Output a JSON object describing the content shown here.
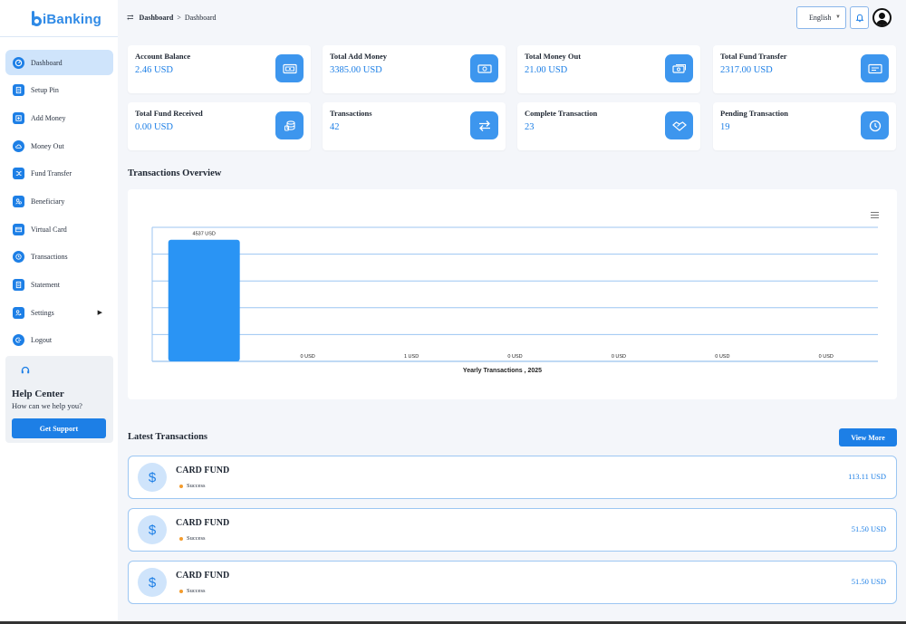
{
  "app": {
    "logo_text": "iBanking"
  },
  "sidebar": {
    "items": [
      {
        "label": "Dashboard",
        "icon": "dashboard-icon",
        "active": true
      },
      {
        "label": "Setup Pin",
        "icon": "document-icon"
      },
      {
        "label": "Add Money",
        "icon": "add-money-icon"
      },
      {
        "label": "Money Out",
        "icon": "cloud-upload-icon"
      },
      {
        "label": "Fund Transfer",
        "icon": "shuffle-icon"
      },
      {
        "label": "Beneficiary",
        "icon": "users-icon"
      },
      {
        "label": "Virtual Card",
        "icon": "credit-card-icon"
      },
      {
        "label": "Transactions",
        "icon": "history-icon"
      },
      {
        "label": "Statement",
        "icon": "statement-icon"
      },
      {
        "label": "Settings",
        "icon": "settings-icon",
        "has_submenu": true
      },
      {
        "label": "Logout",
        "icon": "logout-icon"
      }
    ],
    "help": {
      "title": "Help Center",
      "subtitle": "How can we help you?",
      "button": "Get Support"
    }
  },
  "header": {
    "breadcrumb_root": "Dashboard",
    "breadcrumb_sep": ">",
    "breadcrumb_current": "Dashboard",
    "language": "English"
  },
  "stats": [
    {
      "label": "Account Balance",
      "value": "2.46 USD",
      "icon": "wallet-icon"
    },
    {
      "label": "Total Add Money",
      "value": "3385.00 USD",
      "icon": "cash-icon"
    },
    {
      "label": "Total Money Out",
      "value": "21.00 USD",
      "icon": "money-out-icon"
    },
    {
      "label": "Total Fund Transfer",
      "value": "2317.00 USD",
      "icon": "transfer-card-icon"
    },
    {
      "label": "Total Fund Received",
      "value": "0.00 USD",
      "icon": "coins-icon"
    },
    {
      "label": "Transactions",
      "value": "42",
      "icon": "exchange-icon"
    },
    {
      "label": "Complete Transaction",
      "value": "23",
      "icon": "handshake-icon"
    },
    {
      "label": "Pending Transaction",
      "value": "19",
      "icon": "clock-icon"
    }
  ],
  "overview": {
    "title": "Transactions Overview"
  },
  "chart_data": {
    "type": "bar",
    "xlabel": "Yearly Transactions , 2025",
    "ylabel": "",
    "categories": [
      "",
      "",
      "",
      "",
      "",
      "",
      ""
    ],
    "values": [
      4537,
      0,
      1,
      0,
      0,
      0,
      0
    ],
    "data_labels": [
      "4537 USD",
      "0 USD",
      "1 USD",
      "0 USD",
      "0 USD",
      "0 USD",
      "0 USD"
    ],
    "ylim": [
      0,
      5000
    ],
    "grid": true,
    "bar_color": "#2a94f4"
  },
  "latest": {
    "title": "Latest Transactions",
    "view_more": "View More",
    "items": [
      {
        "name": "CARD FUND",
        "status": "Success",
        "amount": "113.11 USD"
      },
      {
        "name": "CARD FUND",
        "status": "Success",
        "amount": "51.50 USD"
      },
      {
        "name": "CARD FUND",
        "status": "Success",
        "amount": "51.50 USD"
      }
    ]
  },
  "colors": {
    "accent": "#1d7fe6",
    "icon_bg": "#3d96ee",
    "active_nav": "#cfe4fb",
    "status_dot": "#f39c2d"
  }
}
